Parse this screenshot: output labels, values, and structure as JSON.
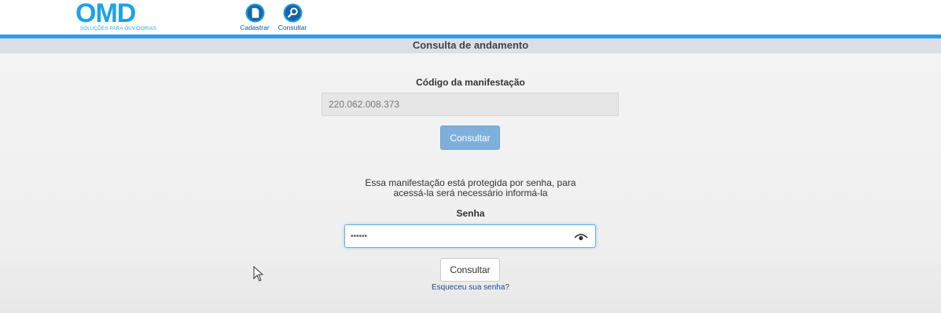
{
  "header": {
    "logo_text": "OMD",
    "logo_subtitle": "SOLUÇÕES PARA OUVIDORIAS",
    "nav": [
      {
        "label": "Cadastrar",
        "icon": "document-icon"
      },
      {
        "label": "Consultar",
        "icon": "search-icon"
      }
    ]
  },
  "page": {
    "section_title": "Consulta de andamento"
  },
  "form": {
    "code_label": "Código da manifestação",
    "code_value": "220.062.008.373",
    "consult_label": "Consultar",
    "protected_notice_line1": "Essa manifestação está protegida por senha, para",
    "protected_notice_line2": "acessá-la será necessário informá-la",
    "password_label": "Senha",
    "password_value": "••••••",
    "consult_password_label": "Consultar",
    "forgot_link": "Esqueceu sua senha?"
  },
  "colors": {
    "brand": "#1aa3e8",
    "rule": "#22a3e6",
    "primary_button": "#7fb0dd",
    "link": "#1b4f8a"
  }
}
